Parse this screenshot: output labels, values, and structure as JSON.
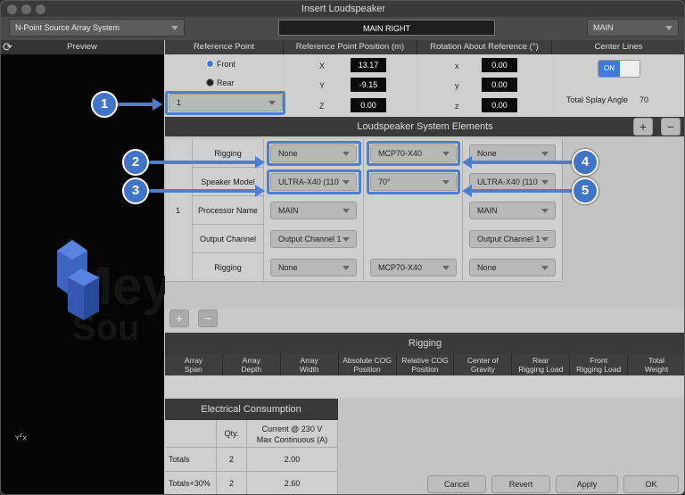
{
  "window": {
    "title": "Insert Loudspeaker"
  },
  "toolbar": {
    "system_type": "N-Point Source Array System",
    "array_name": "MAIN RIGHT",
    "group": "MAIN"
  },
  "headers": {
    "preview": "Preview",
    "reference_point": "Reference Point",
    "ref_position": "Reference Point Position (m)",
    "rotation": "Rotation About Reference (°)",
    "center_lines": "Center Lines"
  },
  "reference": {
    "front_label": "Front",
    "rear_label": "Rear",
    "point_value": "1"
  },
  "position": {
    "x_label": "X",
    "x_value": "13.17",
    "y_label": "Y",
    "y_value": "-9.15",
    "z_label": "Z",
    "z_value": "0.00"
  },
  "rotation": {
    "x_label": "x",
    "x_value": "0.00",
    "y_label": "y",
    "y_value": "0.00",
    "z_label": "z",
    "z_value": "0.00"
  },
  "center_lines": {
    "toggle_label": "ON",
    "splay_label": "Total Splay Angle",
    "splay_value": "70"
  },
  "elements": {
    "title": "Loudspeaker System Elements",
    "index": "1",
    "row_labels": [
      "Rigging",
      "Speaker Model",
      "Processor Name",
      "Output Channel",
      "Rigging"
    ],
    "col1": [
      "None",
      "ULTRA-X40 (110",
      "MAIN",
      "Output Channel 1",
      "None"
    ],
    "col2_rigging": "MCP70-X40",
    "col2_angle": "70°",
    "col2_rigging_bottom": "MCP70-X40",
    "col3": [
      "None",
      "ULTRA-X40 (110",
      "MAIN",
      "Output Channel 1",
      "None"
    ]
  },
  "callouts": [
    "1",
    "2",
    "3",
    "4",
    "5"
  ],
  "rigging": {
    "title": "Rigging",
    "columns": [
      [
        "Array",
        "Span"
      ],
      [
        "Array",
        "Depth"
      ],
      [
        "Array",
        "Width"
      ],
      [
        "Absolute COG",
        "Position"
      ],
      [
        "Relative COG",
        "Position"
      ],
      [
        "Center of",
        "Gravity"
      ],
      [
        "Rear",
        "Rigging Load"
      ],
      [
        "Front",
        "Rigging Load"
      ],
      [
        "Total",
        "Weight"
      ]
    ]
  },
  "electrical": {
    "title": "Electrical Consumption",
    "qty_header": "Qty.",
    "current_header_1": "Current @ 230 V",
    "current_header_2": "Max Continuous (A)",
    "rows": [
      {
        "label": "Totals",
        "qty": "2",
        "current": "2.00"
      },
      {
        "label": "Totals+30%",
        "qty": "2",
        "current": "2.60"
      }
    ]
  },
  "buttons": {
    "cancel": "Cancel",
    "revert": "Revert",
    "apply": "Apply",
    "ok": "OK"
  },
  "preview": {
    "watermark_1": "Mey",
    "watermark_2": "Sou"
  },
  "axis": {
    "y": "Y",
    "z": "Z",
    "x": "X"
  }
}
